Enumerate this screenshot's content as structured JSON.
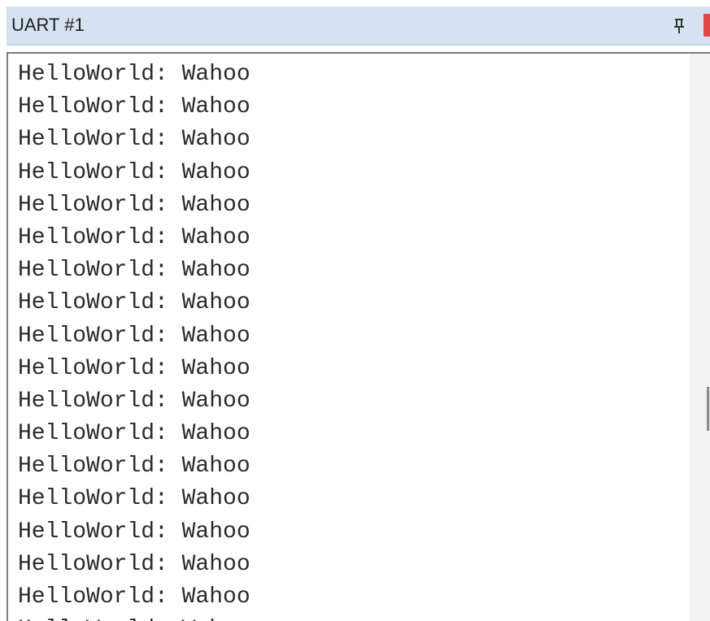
{
  "window": {
    "title": "UART #1",
    "pin_icon": "pin-icon",
    "close_icon": "close-icon",
    "close_color": "#e24848"
  },
  "output": {
    "lines": [
      "HelloWorld: Wahoo",
      "HelloWorld: Wahoo",
      "HelloWorld: Wahoo",
      "HelloWorld: Wahoo",
      "HelloWorld: Wahoo",
      "HelloWorld: Wahoo",
      "HelloWorld: Wahoo",
      "HelloWorld: Wahoo",
      "HelloWorld: Wahoo",
      "HelloWorld: Wahoo",
      "HelloWorld: Wahoo",
      "HelloWorld: Wahoo",
      "HelloWorld: Wahoo",
      "HelloWorld: Wahoo",
      "HelloWorld: Wahoo",
      "HelloWorld: Wahoo",
      "HelloWorld: Wahoo",
      "HelloWorld: Wahoo"
    ]
  }
}
